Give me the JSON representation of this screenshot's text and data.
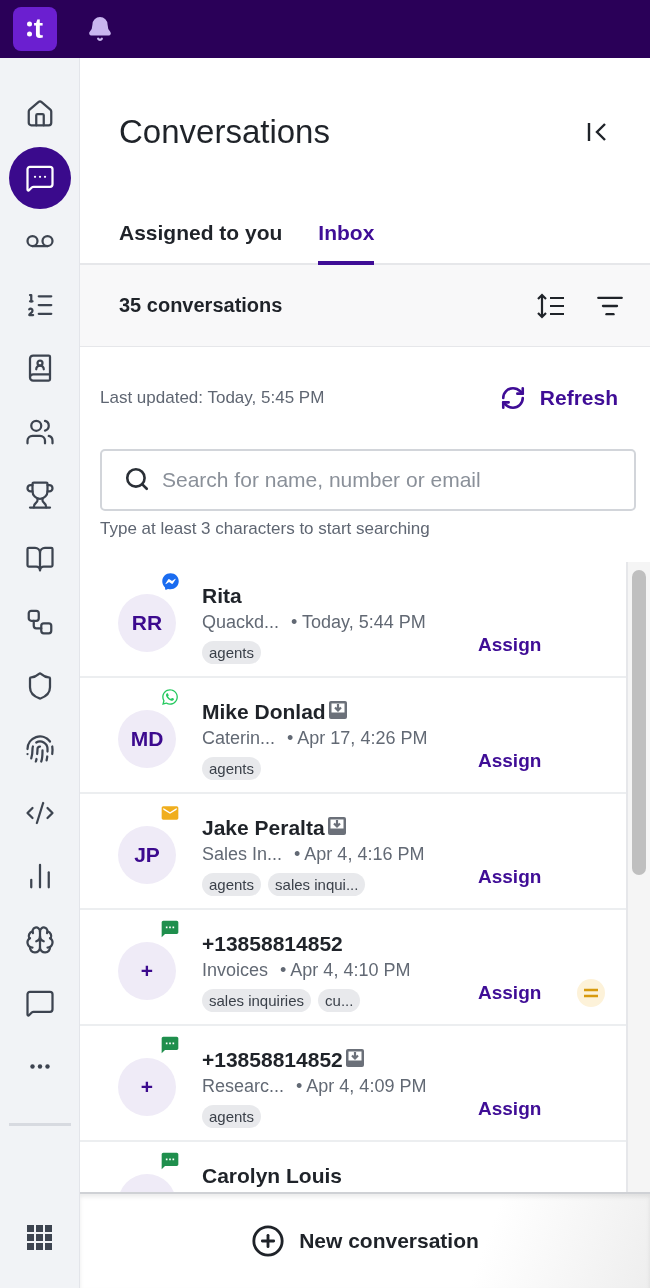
{
  "top_bar": {
    "logo_text": "t",
    "notifications": true
  },
  "sidebar": {
    "items": [
      {
        "kind": "home",
        "selected": false
      },
      {
        "kind": "conversations",
        "selected": true
      },
      {
        "kind": "voicemail",
        "selected": false
      },
      {
        "kind": "queues",
        "selected": false
      },
      {
        "kind": "contacts",
        "selected": false
      },
      {
        "kind": "teams",
        "selected": false
      },
      {
        "kind": "trophy",
        "selected": false
      },
      {
        "kind": "book",
        "selected": false
      },
      {
        "kind": "workflow",
        "selected": false
      },
      {
        "kind": "shield",
        "selected": false
      },
      {
        "kind": "fingerprint",
        "selected": false
      },
      {
        "kind": "code",
        "selected": false
      },
      {
        "kind": "analytics",
        "selected": false
      },
      {
        "kind": "brain",
        "selected": false
      },
      {
        "kind": "chat",
        "selected": false
      },
      {
        "kind": "more",
        "selected": false
      }
    ],
    "bottom": {
      "kind": "apps",
      "selected": false
    }
  },
  "header": {
    "title": "Conversations"
  },
  "tabs": [
    {
      "label": "Assigned to you",
      "selected": false
    },
    {
      "label": "Inbox",
      "selected": true
    }
  ],
  "toolbar": {
    "count": "35 conversations"
  },
  "status": {
    "last_updated": "Last updated: Today, 5:45 PM",
    "refresh": "Refresh"
  },
  "search": {
    "placeholder": "Search for name, number or email",
    "hint": "Type at least 3 characters to start searching"
  },
  "conversations": [
    {
      "initials": "RR",
      "kind": "messenger",
      "name": "Rita",
      "moved_to_inbox": false,
      "priority_marked": false,
      "source": "Quackd...",
      "time": "• Today, 5:44 PM",
      "tags": [
        "agents"
      ],
      "action": "Assign"
    },
    {
      "initials": "MD",
      "kind": "whatsapp",
      "name": "Mike Donlad",
      "moved_to_inbox": true,
      "priority_marked": false,
      "source": "Caterin...",
      "time": "• Apr 17, 4:26 PM",
      "tags": [
        "agents"
      ],
      "action": "Assign"
    },
    {
      "initials": "JP",
      "kind": "email",
      "name": "Jake Peralta",
      "moved_to_inbox": true,
      "priority_marked": false,
      "source": "Sales In...",
      "time": "• Apr 4, 4:16 PM",
      "tags": [
        "agents",
        "sales inqui..."
      ],
      "action": "Assign"
    },
    {
      "initials": "+",
      "kind": "sms",
      "name": "+13858814852",
      "moved_to_inbox": false,
      "priority_marked": true,
      "source": "Invoices",
      "time": "• Apr 4, 4:10 PM",
      "tags": [
        "sales inquiries",
        "cu..."
      ],
      "action": "Assign"
    },
    {
      "initials": "+",
      "kind": "sms",
      "name": "+13858814852",
      "moved_to_inbox": true,
      "priority_marked": false,
      "source": "Researc...",
      "time": "• Apr 4, 4:09 PM",
      "tags": [
        "agents"
      ],
      "action": "Assign"
    },
    {
      "kind": "sms",
      "name": "Carolyn Louis",
      "moved_to_inbox": false,
      "priority_marked": false
    }
  ],
  "footer": {
    "new_conversation": "New conversation"
  }
}
